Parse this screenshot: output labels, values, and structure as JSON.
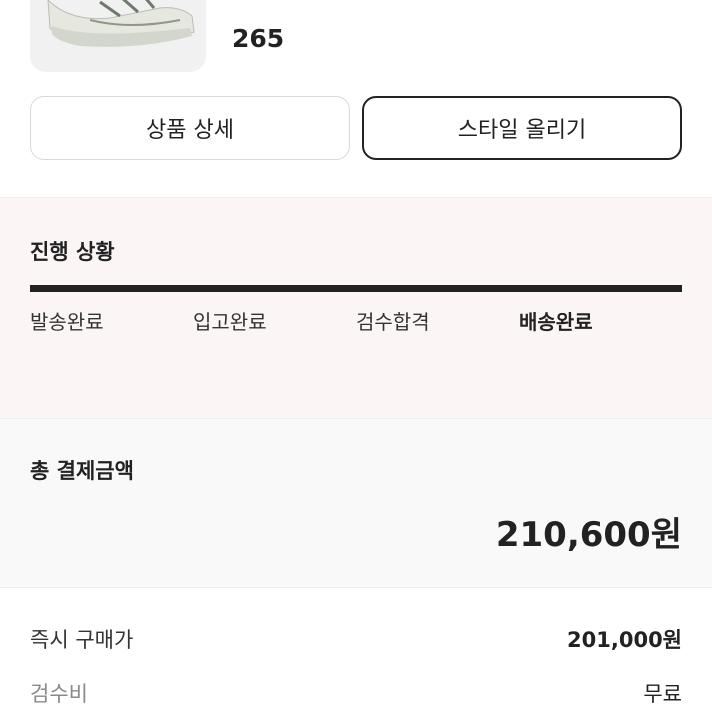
{
  "product": {
    "image_icon": "sneaker-image",
    "size": "265"
  },
  "buttons": {
    "detail_label": "상품 상세",
    "style_label": "스타일 올리기"
  },
  "progress": {
    "title": "진행 상황",
    "steps": [
      "발송완료",
      "입고완료",
      "검수합격",
      "배송완료"
    ],
    "active_step": "배송완료",
    "completion": 1.0
  },
  "payment": {
    "total_label": "총 결제금액",
    "total_amount": "210,600원",
    "lines": [
      {
        "label": "즉시 구매가",
        "value": "201,000원"
      },
      {
        "label": "검수비",
        "value": "무료"
      }
    ]
  },
  "colors": {
    "progress_bg": "#fcf5f5",
    "total_bg": "#f9f9f9",
    "accent": "#222222"
  }
}
